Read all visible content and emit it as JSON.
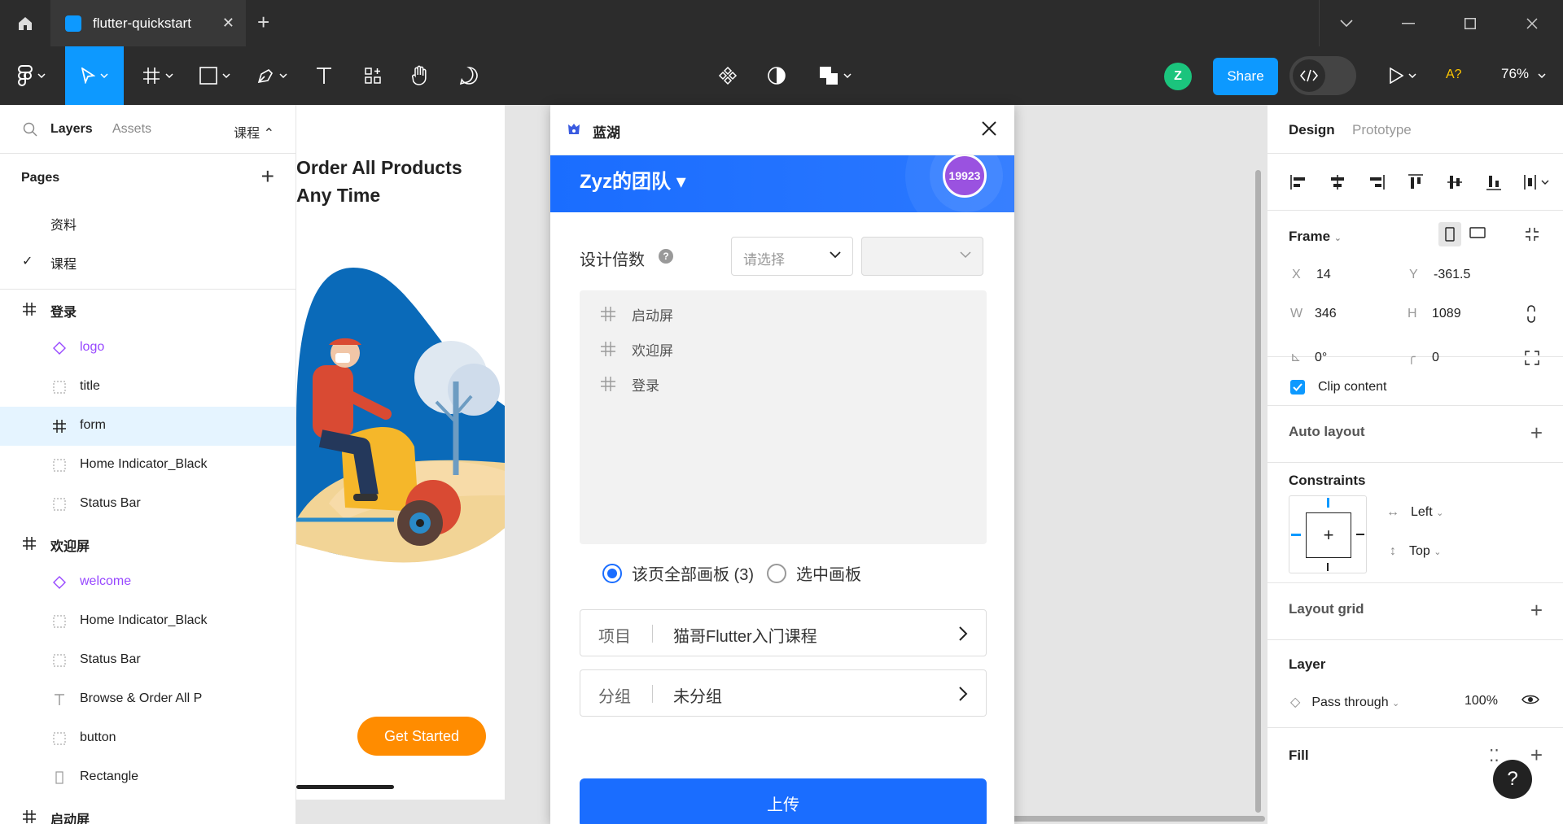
{
  "titlebar": {
    "tab_title": "flutter-quickstart",
    "tab_close": "✕",
    "new_tab": "+"
  },
  "toolbar": {
    "avatar_initial": "Z",
    "share_label": "Share",
    "ai_label": "A?",
    "zoom": "76%"
  },
  "left_panel": {
    "tab_layers": "Layers",
    "tab_assets": "Assets",
    "current_page": "课程 ⌃",
    "pages_title": "Pages",
    "pages_add": "+",
    "pages": [
      {
        "label": "资料",
        "checked": false
      },
      {
        "label": "课程",
        "checked": true
      }
    ],
    "layers": [
      {
        "label": "登录",
        "kind": "frame"
      },
      {
        "label": "logo",
        "kind": "component"
      },
      {
        "label": "title",
        "kind": "group"
      },
      {
        "label": "form",
        "kind": "frame-child"
      },
      {
        "label": "Home Indicator_Black",
        "kind": "group"
      },
      {
        "label": "Status Bar",
        "kind": "group"
      },
      {
        "label": "欢迎屏",
        "kind": "frame"
      },
      {
        "label": "welcome",
        "kind": "component"
      },
      {
        "label": "Home Indicator_Black",
        "kind": "group"
      },
      {
        "label": "Status Bar",
        "kind": "group"
      },
      {
        "label": "Browse & Order All P",
        "kind": "text"
      },
      {
        "label": "button",
        "kind": "group"
      },
      {
        "label": "Rectangle",
        "kind": "rect"
      },
      {
        "label": "启动屏",
        "kind": "frame"
      }
    ]
  },
  "canvas": {
    "headline_line1": "Order All Products",
    "headline_line2": "Any Time",
    "cta": "Get Started"
  },
  "dialog": {
    "title": "蓝湖",
    "team_name": "Zyz的团队 ▾",
    "badge": "19923",
    "scale_label": "设计倍数",
    "scale_help": "?",
    "scale_placeholder": "请选择",
    "frames": [
      "启动屏",
      "欢迎屏",
      "登录"
    ],
    "radio_all": "该页全部画板 (3)",
    "radio_selected": "选中画板",
    "project_key": "项目",
    "project_value": "猫哥Flutter入门课程",
    "group_key": "分组",
    "group_value": "未分组",
    "upload": "上传"
  },
  "right_panel": {
    "tab_design": "Design",
    "tab_prototype": "Prototype",
    "frame_title": "Frame",
    "x_label": "X",
    "x_value": "14",
    "y_label": "Y",
    "y_value": "-361.5",
    "w_label": "W",
    "w_value": "346",
    "h_label": "H",
    "h_value": "1089",
    "rotation": "0°",
    "radius": "0",
    "clip_content": "Clip content",
    "auto_layout": "Auto layout",
    "constraints": "Constraints",
    "constraint_h": "Left",
    "constraint_v": "Top",
    "layout_grid": "Layout grid",
    "layer_title": "Layer",
    "blend_mode": "Pass through",
    "opacity": "100%",
    "fill_title": "Fill",
    "help": "?"
  },
  "colors": {
    "figma_blue": "#0d99ff",
    "lanhu_blue": "#1a6dff",
    "cta_orange": "#ff8c00",
    "component_purple": "#9747ff"
  }
}
